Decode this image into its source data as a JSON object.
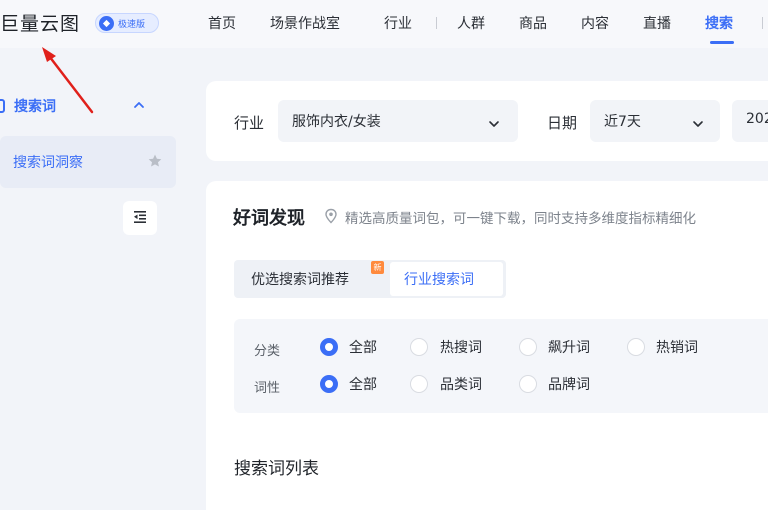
{
  "header": {
    "logo_text": "巨量云图",
    "badge_text": "极速版",
    "nav": [
      {
        "label": "首页"
      },
      {
        "label": "场景作战室"
      },
      {
        "label": "行业"
      },
      {
        "label": "人群"
      },
      {
        "label": "商品"
      },
      {
        "label": "内容"
      },
      {
        "label": "直播"
      },
      {
        "label": "搜索",
        "active": true
      }
    ]
  },
  "sidebar": {
    "group_label": "搜索词",
    "items": [
      {
        "label": "搜索词洞察",
        "active": true
      }
    ]
  },
  "filters": {
    "industry_label": "行业",
    "industry_value": "服饰内衣/女装",
    "date_label": "日期",
    "date_value": "近7天",
    "date_range_value": "202"
  },
  "discovery": {
    "title": "好词发现",
    "hint": "精选高质量词包，可一键下载，同时支持多维度指标精细化",
    "tabs": [
      {
        "label": "优选搜索词推荐",
        "badge": "新"
      },
      {
        "label": "行业搜索词",
        "active": true
      }
    ],
    "category": {
      "label": "分类",
      "options": [
        "全部",
        "热搜词",
        "飙升词",
        "热销词"
      ],
      "selected": "全部"
    },
    "word_type": {
      "label": "词性",
      "options": [
        "全部",
        "品类词",
        "品牌词"
      ],
      "selected": "全部"
    }
  },
  "list": {
    "title": "搜索词列表"
  },
  "colors": {
    "accent": "#3b6ef6",
    "annotation": "#e0201b"
  }
}
